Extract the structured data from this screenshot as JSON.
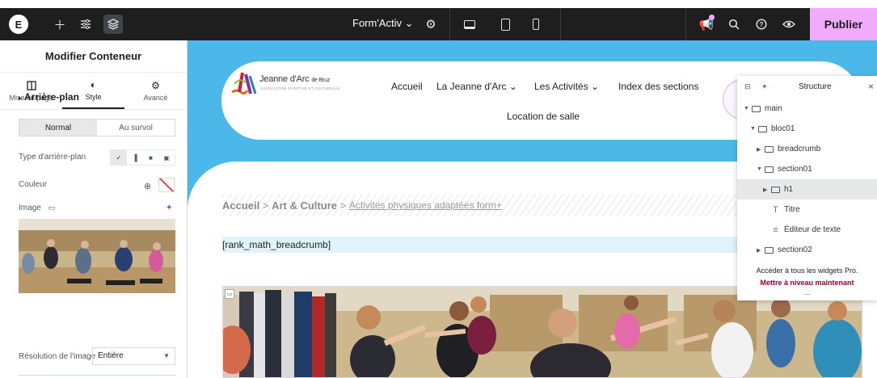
{
  "topbar": {
    "document_name": "Form'Activ",
    "document_caret": "⌄",
    "publish_label": "Publier",
    "accent_color": "#f0abfc"
  },
  "panel": {
    "title": "Modifier Conteneur",
    "tabs": [
      {
        "label": "Mise en page",
        "icon": "layout-icon"
      },
      {
        "label": "Style",
        "icon": "contrast-icon",
        "active": true
      },
      {
        "label": "Avancé",
        "icon": "gear-icon"
      }
    ],
    "section": "Arrière-plan",
    "state_tabs": [
      "Normal",
      "Au survol"
    ],
    "bg_type_label": "Type d'arrière-plan",
    "color_label": "Couleur",
    "image_label": "Image",
    "resolution_label": "Résolution de l'image",
    "resolution_value": "Entière"
  },
  "site": {
    "logo_name": "Jeanne d'Arc",
    "logo_suffix": "de Bruz",
    "logo_tagline": "ASSOCIATION SPORTIVE ET CULTURELLE",
    "nav": [
      "Accueil",
      "La Jeanne d'Arc",
      "Les Activités",
      "Index des sections",
      "Location de salle"
    ],
    "nav_caret": "⌄"
  },
  "page": {
    "breadcrumb_home": "Accueil",
    "breadcrumb_sep": ">",
    "breadcrumb_parent": "Art & Culture",
    "breadcrumb_current": "Activités physiques adaptées form+",
    "shortcode": "[rank_math_breadcrumb]"
  },
  "structure": {
    "title": "Structure",
    "nodes": [
      {
        "label": "main",
        "kind": "container",
        "expanded": true
      },
      {
        "label": "bloc01",
        "kind": "container",
        "expanded": true
      },
      {
        "label": "breadcrumb",
        "kind": "container",
        "expanded": false
      },
      {
        "label": "section01",
        "kind": "container",
        "expanded": true
      },
      {
        "label": "h1",
        "kind": "container",
        "expanded": false,
        "active": true
      },
      {
        "label": "Titre",
        "kind": "heading-widget"
      },
      {
        "label": "Éditeur de texte",
        "kind": "text-widget"
      },
      {
        "label": "section02",
        "kind": "container",
        "expanded": false
      }
    ],
    "promo_text": "Accéder à tous les widgets Pro.",
    "promo_link": "Mettre à niveau maintenant",
    "more": "..."
  }
}
